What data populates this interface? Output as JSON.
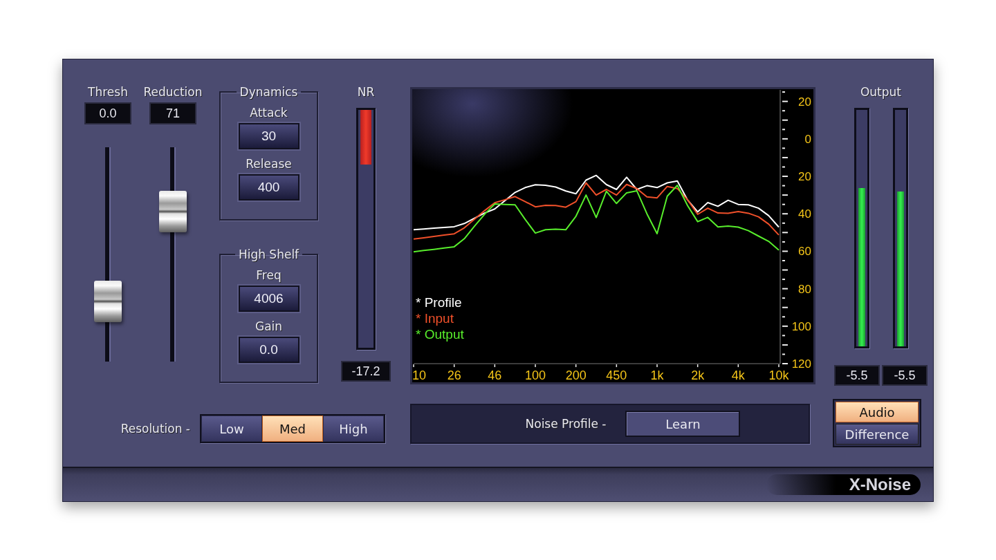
{
  "sliders": [
    {
      "label": "Thresh",
      "value": "0.0",
      "level": 0.28
    },
    {
      "label": "Reduction",
      "value": "71",
      "level": 0.7
    }
  ],
  "groups": [
    {
      "title": "Dynamics",
      "fields": [
        {
          "label": "Attack",
          "value": "30"
        },
        {
          "label": "Release",
          "value": "400"
        }
      ]
    },
    {
      "title": "High Shelf",
      "fields": [
        {
          "label": "Freq",
          "value": "4006"
        },
        {
          "label": "Gain",
          "value": "0.0"
        }
      ]
    }
  ],
  "nr_meter": {
    "label": "NR",
    "level": 0.23,
    "reading": "-17.2"
  },
  "spectrum": {
    "legend_marker": "*",
    "chart_data": {
      "type": "line",
      "categories": [
        "10",
        null,
        null,
        null,
        "26",
        null,
        null,
        null,
        "46",
        null,
        null,
        null,
        "100",
        null,
        null,
        null,
        "200",
        null,
        null,
        null,
        "450",
        null,
        null,
        null,
        "1k",
        null,
        null,
        null,
        "2k",
        null,
        null,
        null,
        "4k",
        null,
        null,
        null,
        "10k"
      ],
      "ylim": [
        -120,
        26
      ],
      "yticks": [
        {
          "value": 20,
          "label": "20"
        },
        {
          "value": 0,
          "label": "0"
        },
        {
          "value": -20,
          "label": "20"
        },
        {
          "value": -40,
          "label": "40"
        },
        {
          "value": -60,
          "label": "60"
        },
        {
          "value": -80,
          "label": "80"
        },
        {
          "value": -100,
          "label": "100"
        },
        {
          "value": -120,
          "label": "120"
        }
      ],
      "series": [
        {
          "name": "Profile",
          "color": "#ffffff",
          "values": [
            -48.5,
            -48.1,
            -47.7,
            -47.3,
            -46.9,
            -45.2,
            -42.4,
            -39.6,
            -37.4,
            -33,
            -28.6,
            -26,
            -24.5,
            -24.8,
            -25.7,
            -27.8,
            -29.3,
            -22,
            -19.5,
            -24.4,
            -27,
            -20.5,
            -27,
            -25,
            -26,
            -23.5,
            -22.5,
            -32.6,
            -39,
            -34,
            -36,
            -32.8,
            -35,
            -35.2,
            -37,
            -41,
            -47.1
          ]
        },
        {
          "name": "Input",
          "color": "#f0502a",
          "values": [
            -53.5,
            -52.8,
            -52.1,
            -51.4,
            -50.7,
            -47.5,
            -42.9,
            -38.3,
            -34.1,
            -32.5,
            -30.8,
            -33.5,
            -36.3,
            -35.5,
            -35.6,
            -36.5,
            -33.5,
            -23.5,
            -30,
            -27,
            -30,
            -24.3,
            -26.5,
            -31,
            -31.5,
            -25.4,
            -26.5,
            -32.5,
            -40.3,
            -37,
            -39.6,
            -39.7,
            -38.8,
            -39.7,
            -41.6,
            -45.5,
            -51.3
          ]
        },
        {
          "name": "Output",
          "color": "#58ee2c",
          "values": [
            -60.3,
            -59.6,
            -59,
            -58.3,
            -57.6,
            -53.3,
            -46.6,
            -40.2,
            -34.8,
            -35,
            -35.2,
            -43,
            -50.3,
            -48.5,
            -48.2,
            -48.5,
            -41.3,
            -30,
            -42,
            -28,
            -34.5,
            -28.8,
            -27.7,
            -40,
            -50.6,
            -30.6,
            -24.8,
            -35.6,
            -44.2,
            -41.9,
            -47,
            -46.6,
            -47.1,
            -49,
            -51.9,
            -54.7,
            -59.4
          ]
        }
      ]
    }
  },
  "output": {
    "label": "Output",
    "meters": [
      {
        "level": 0.67,
        "reading": "-5.5"
      },
      {
        "level": 0.655,
        "reading": "-5.5"
      }
    ],
    "monitor_buttons": [
      {
        "label": "Audio",
        "selected": true
      },
      {
        "label": "Difference",
        "selected": false
      }
    ]
  },
  "resolution": {
    "label": "Resolution -",
    "options": [
      {
        "label": "Low",
        "selected": false
      },
      {
        "label": "Med",
        "selected": true
      },
      {
        "label": "High",
        "selected": false
      }
    ]
  },
  "noise_profile": {
    "label": "Noise Profile -",
    "button": "Learn"
  },
  "product_name": "X-Noise"
}
